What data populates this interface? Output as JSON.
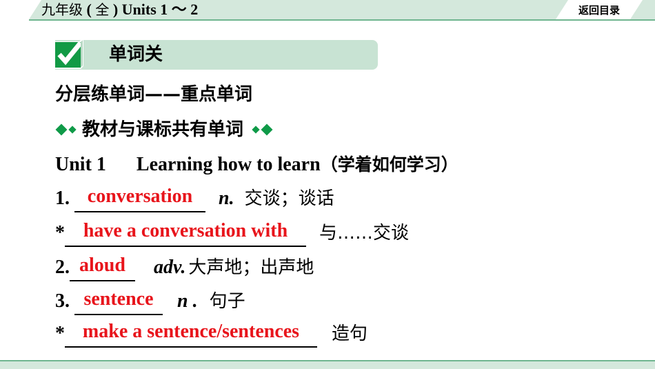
{
  "header": {
    "title_cjk": "九年级",
    "title_paren_open": " ( ",
    "title_paren_cjk": "全",
    "title_paren_close": " ) ",
    "title_rest": "Units 1 ～ 2",
    "back_button_label": "返回目录"
  },
  "section": {
    "icon": "checkmark-icon",
    "title": "单词关"
  },
  "sub_heading": "分层练单词——重点单词",
  "category_heading": "教材与课标共有单词",
  "unit": {
    "label": "Unit 1",
    "title_en": "Learning how to learn",
    "title_cn": "（学着如何学习）"
  },
  "items": [
    {
      "prefix": "1. ",
      "answer": "conversation",
      "pos": "n.",
      "meaning": "交谈；谈话"
    },
    {
      "prefix": "*",
      "answer": "have a conversation with",
      "pos": "",
      "meaning": "与……交谈"
    },
    {
      "prefix": "2.",
      "answer": "aloud",
      "pos": "adv.",
      "meaning": "大声地；出声地"
    },
    {
      "prefix": "3. ",
      "answer": "sentence",
      "pos": "n .",
      "meaning": "句子"
    },
    {
      "prefix": "*",
      "answer": "make a sentence/sentences",
      "pos": "",
      "meaning": "造句"
    }
  ],
  "colors": {
    "accent_green": "#0f9a48",
    "band_green": "#d4e8dc",
    "answer_red": "#e8141b"
  }
}
